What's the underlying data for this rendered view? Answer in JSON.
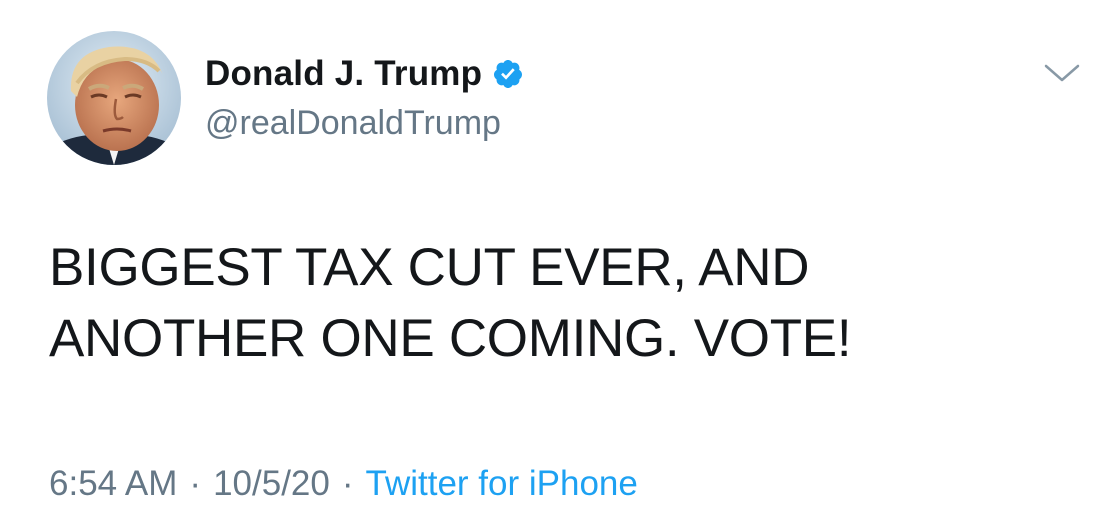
{
  "author": {
    "display_name": "Donald J. Trump",
    "handle": "@realDonaldTrump",
    "verified": true,
    "avatar_icon": "profile-photo"
  },
  "tweet": {
    "lines": [
      "BIGGEST TAX CUT EVER, AND",
      "ANOTHER ONE COMING. VOTE!"
    ]
  },
  "meta": {
    "time": "6:54 AM",
    "separator": "·",
    "date": "10/5/20",
    "source": "Twitter for iPhone"
  },
  "colors": {
    "text": "#14171a",
    "secondary": "#657786",
    "link": "#1da1f2",
    "verified": "#1da1f2"
  },
  "icons": {
    "verified": "verified-badge-icon",
    "menu": "chevron-down-icon"
  }
}
